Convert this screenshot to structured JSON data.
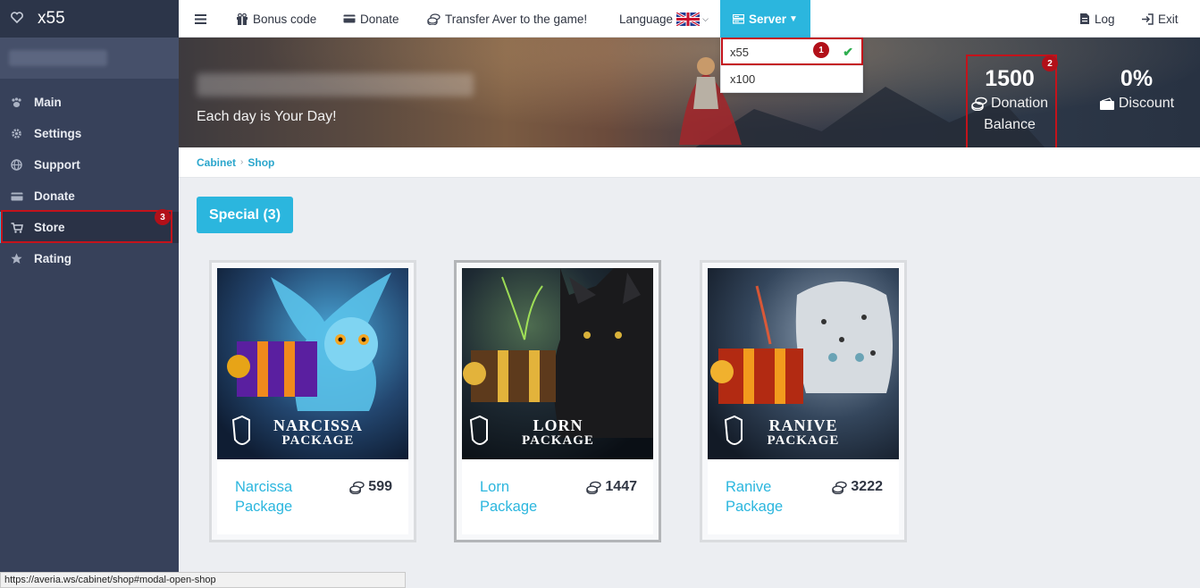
{
  "sidebar": {
    "app_title": "x55",
    "icon": "heart-icon",
    "items": [
      {
        "label": "Main",
        "icon": "paw-icon"
      },
      {
        "label": "Settings",
        "icon": "gear-icon"
      },
      {
        "label": "Support",
        "icon": "globe-icon"
      },
      {
        "label": "Donate",
        "icon": "card-icon"
      },
      {
        "label": "Store",
        "icon": "cart-icon",
        "active": true
      },
      {
        "label": "Rating",
        "icon": "star-icon"
      }
    ]
  },
  "topnav": {
    "menu_icon": "hamburger-icon",
    "bonus_code": "Bonus code",
    "donate": "Donate",
    "transfer": "Transfer Aver to the game!",
    "language": "Language",
    "server": "Server",
    "log": "Log",
    "exit": "Exit"
  },
  "server_dropdown": {
    "options": [
      "x55",
      "x100"
    ],
    "selected": "x55"
  },
  "banner": {
    "motto": "Each day is Your Day!",
    "balance_value": "1500",
    "balance_label_1": "Donation",
    "balance_label_2": "Balance",
    "discount_value": "0%",
    "discount_label": "Discount"
  },
  "annotations": [
    "1",
    "2",
    "3"
  ],
  "breadcrumb": {
    "items": [
      "Cabinet",
      "Shop"
    ]
  },
  "section": {
    "special_label": "Special (3)"
  },
  "products": [
    {
      "name_line1": "Narcissa",
      "name_line2": "Package",
      "price": "599",
      "art_title_1": "NARCISSA",
      "art_title_2": "PACKAGE"
    },
    {
      "name_line1": "Lorn",
      "name_line2": "Package",
      "price": "1447",
      "art_title_1": "LORN",
      "art_title_2": "PACKAGE"
    },
    {
      "name_line1": "Ranive",
      "name_line2": "Package",
      "price": "3222",
      "art_title_1": "RANIVE",
      "art_title_2": "PACKAGE"
    }
  ],
  "status_url": "https://averia.ws/cabinet/shop#modal-open-shop",
  "colors": {
    "accent": "#2bb6de",
    "sidebar": "#37415a",
    "highlight": "#c4131b"
  }
}
